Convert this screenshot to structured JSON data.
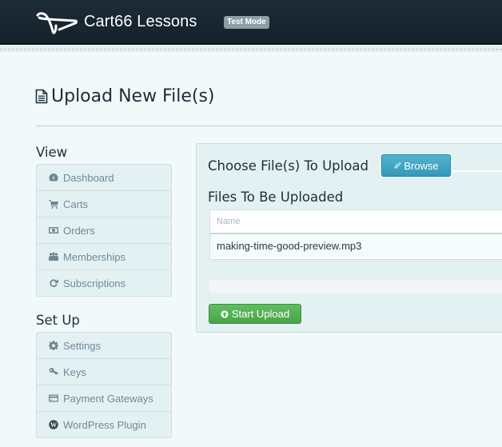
{
  "header": {
    "brand": "Cart66 Lessons",
    "mode_badge": "Test Mode",
    "logo_icon": "cart66-logo-icon"
  },
  "page": {
    "title": "Upload New File(s)",
    "title_icon": "file-text-icon"
  },
  "sidebar": {
    "view": {
      "heading": "View",
      "items": [
        {
          "label": "Dashboard",
          "icon": "dashboard-icon"
        },
        {
          "label": "Carts",
          "icon": "cart-icon"
        },
        {
          "label": "Orders",
          "icon": "money-icon"
        },
        {
          "label": "Memberships",
          "icon": "group-icon"
        },
        {
          "label": "Subscriptions",
          "icon": "refresh-icon"
        }
      ]
    },
    "setup": {
      "heading": "Set Up",
      "items": [
        {
          "label": "Settings",
          "icon": "gear-icon"
        },
        {
          "label": "Keys",
          "icon": "key-icon"
        },
        {
          "label": "Payment Gateways",
          "icon": "credit-card-icon"
        },
        {
          "label": "WordPress Plugin",
          "icon": "wordpress-icon"
        }
      ]
    }
  },
  "upload": {
    "choose_label": "Choose File(s) To Upload",
    "browse_label": "Browse",
    "files_label": "Files To Be Uploaded",
    "table": {
      "columns": [
        "Name"
      ],
      "rows": [
        {
          "name": "making-time-good-preview.mp3"
        }
      ]
    },
    "progress_percent": 0,
    "start_label": "Start Upload"
  },
  "colors": {
    "header_bg": "#1a2a34",
    "browse_btn": "#3fa3c4",
    "start_btn": "#53ad53",
    "badge_bg": "#8d9ea5"
  }
}
